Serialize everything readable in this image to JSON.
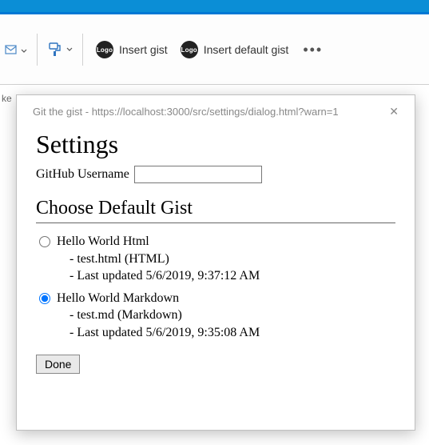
{
  "ribbon": {
    "insert_gist_label": "Insert gist",
    "insert_default_gist_label": "Insert default gist",
    "logo_text": "Logo"
  },
  "below_ribbon": {
    "fragment": "ke"
  },
  "dialog": {
    "title_bar": "Git the gist - https://localhost:3000/src/settings/dialog.html?warn=1",
    "heading": "Settings",
    "username_label": "GitHub Username",
    "username_value": "",
    "subheading": "Choose Default Gist",
    "gists": [
      {
        "name": "Hello World Html",
        "file_line": "- test.html (HTML)",
        "updated_line": "- Last updated 5/6/2019, 9:37:12 AM",
        "selected": false
      },
      {
        "name": "Hello World Markdown",
        "file_line": "- test.md (Markdown)",
        "updated_line": "- Last updated 5/6/2019, 9:35:08 AM",
        "selected": true
      }
    ],
    "done_label": "Done"
  }
}
